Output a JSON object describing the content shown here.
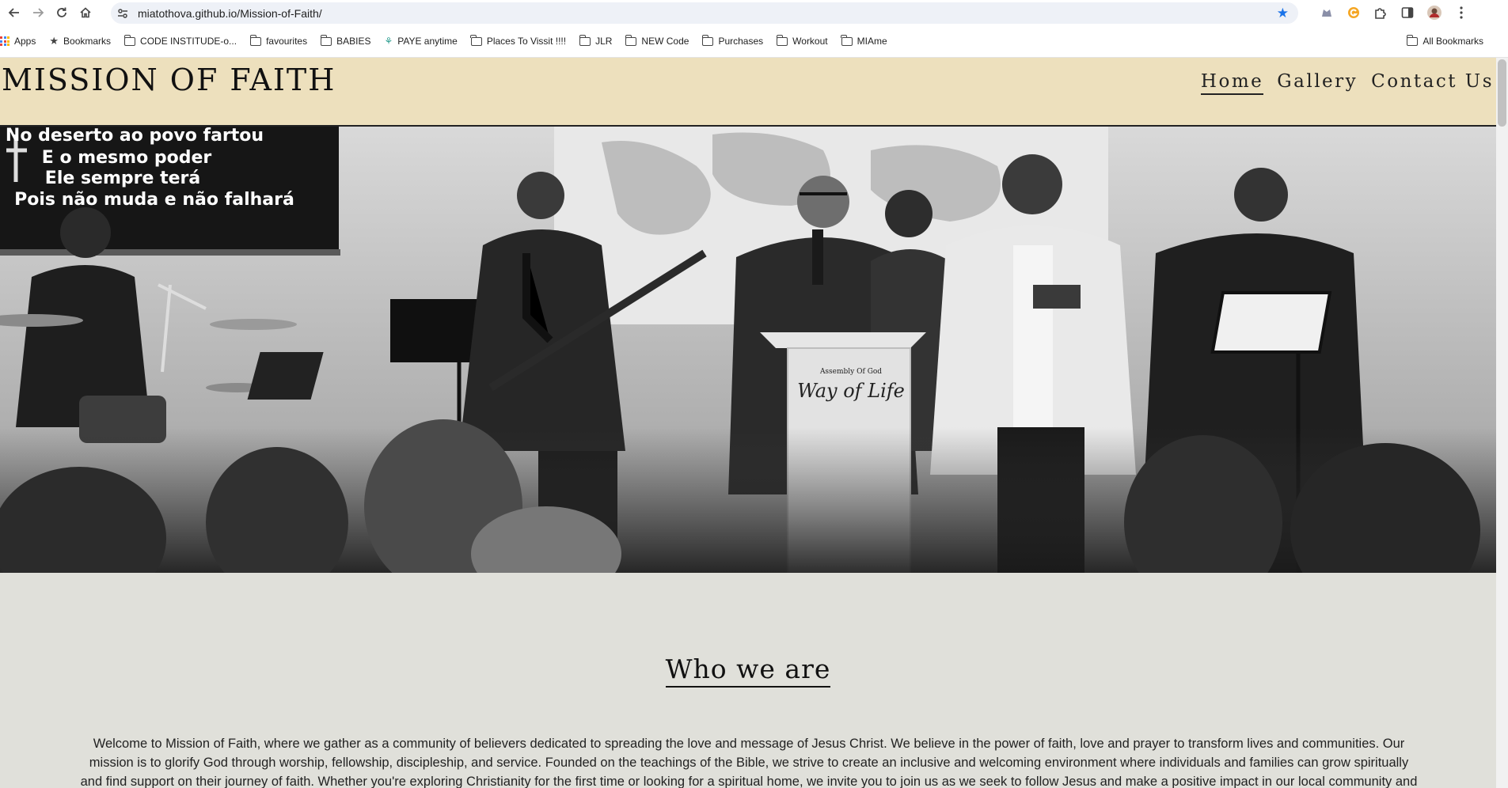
{
  "browser": {
    "url": "miatothova.github.io/Mission-of-Faith/",
    "bookmarks": [
      {
        "label": "Apps",
        "icon": "apps-grid-icon"
      },
      {
        "label": "Bookmarks",
        "icon": "star-icon"
      },
      {
        "label": "CODE INSTITUDE-o...",
        "icon": "folder-icon"
      },
      {
        "label": "favourites",
        "icon": "folder-icon"
      },
      {
        "label": "BABIES",
        "icon": "folder-icon"
      },
      {
        "label": "PAYE anytime",
        "icon": "paye-icon"
      },
      {
        "label": "Places To Vissit !!!!",
        "icon": "folder-icon"
      },
      {
        "label": "JLR",
        "icon": "folder-icon"
      },
      {
        "label": "NEW Code",
        "icon": "folder-icon"
      },
      {
        "label": "Purchases",
        "icon": "folder-icon"
      },
      {
        "label": "Workout",
        "icon": "folder-icon"
      },
      {
        "label": "MIAme",
        "icon": "folder-icon"
      }
    ],
    "all_bookmarks": "All Bookmarks"
  },
  "site": {
    "brand": "MISSION OF FAITH",
    "nav": [
      {
        "label": "Home",
        "active": true
      },
      {
        "label": "Gallery",
        "active": false
      },
      {
        "label": "Contact Us",
        "active": false
      }
    ]
  },
  "hero": {
    "screen_lines": [
      "No deserto ao povo fartou",
      "E o mesmo poder",
      "Ele sempre terá",
      "Pois não muda e não falhará"
    ],
    "pulpit_top": "Assembly Of God",
    "pulpit_logo": "Way of Life"
  },
  "about": {
    "heading": "Who we are",
    "text": "Welcome to Mission of Faith, where we gather as a community of believers dedicated to spreading the love and message of Jesus Christ. We believe in the power of faith, love and prayer to transform lives and communities. Our mission is to glorify God through worship, fellowship, discipleship, and service. Founded on the teachings of the Bible, we strive to create an inclusive and welcoming environment where individuals and families can grow spiritually and find support on their journey of faith. Whether you're exploring Christianity for the first time or looking for a spiritual home, we invite you to join us as we seek to follow Jesus and make a positive impact in our local community and beyond."
  },
  "colors": {
    "header_bg": "#ede0bd",
    "about_bg": "#e0e0da",
    "star_blue": "#1a73e8"
  }
}
